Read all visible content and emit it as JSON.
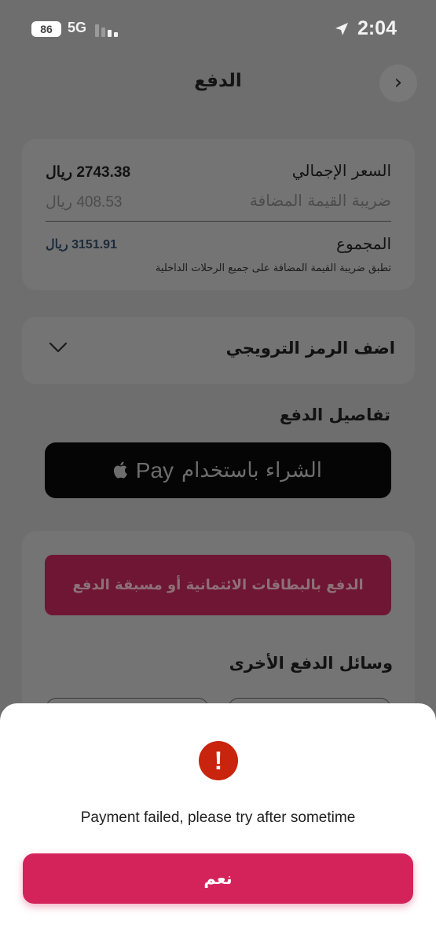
{
  "status_bar": {
    "battery": "86",
    "network": "5G",
    "time": "2:04"
  },
  "header": {
    "title": "الدفع"
  },
  "price_summary": {
    "total_price_label": "السعر الإجمالي",
    "total_price_value": "2743.38 ريال",
    "vat_label": "ضريبة القيمة المضافة",
    "vat_value": "408.53 ريال",
    "grand_total_label": "المجموع",
    "grand_total_value": "3151.91 ريال",
    "vat_note": "تطبق ضريبة القيمة المضافة على جميع الرحلات الداخلية"
  },
  "promo": {
    "label": "اضف الرمز الترويجي"
  },
  "payment": {
    "section_title": "تفاصيل الدفع",
    "apple_pay_text": "الشراء باستخدام",
    "apple_pay_brand": "Pay",
    "card_button_label": "الدفع بالبطاقات الائتمانية أو مسبقة الدفع",
    "other_methods_title": "وسائل الدفع الأخرى"
  },
  "dialog": {
    "message": "Payment failed, please try after sometime",
    "confirm_label": "نعم"
  },
  "colors": {
    "accent": "#d4235b",
    "error": "#c8240e"
  }
}
